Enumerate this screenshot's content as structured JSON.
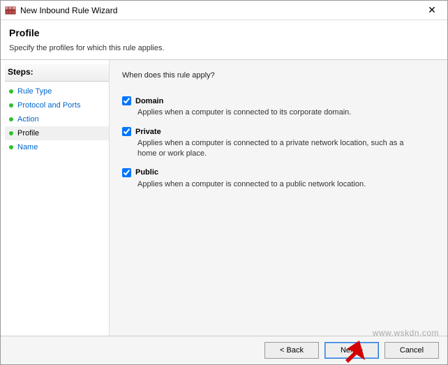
{
  "window": {
    "title": "New Inbound Rule Wizard"
  },
  "header": {
    "title": "Profile",
    "subtitle": "Specify the profiles for which this rule applies."
  },
  "steps": {
    "title": "Steps:",
    "items": [
      {
        "label": "Rule Type",
        "current": false
      },
      {
        "label": "Protocol and Ports",
        "current": false
      },
      {
        "label": "Action",
        "current": false
      },
      {
        "label": "Profile",
        "current": true
      },
      {
        "label": "Name",
        "current": false
      }
    ]
  },
  "content": {
    "question": "When does this rule apply?",
    "options": [
      {
        "title": "Domain",
        "checked": true,
        "desc": "Applies when a computer is connected to its corporate domain."
      },
      {
        "title": "Private",
        "checked": true,
        "desc": "Applies when a computer is connected to a private network location, such as a home or work place."
      },
      {
        "title": "Public",
        "checked": true,
        "desc": "Applies when a computer is connected to a public network location."
      }
    ]
  },
  "footer": {
    "back": "< Back",
    "next": "Next >",
    "cancel": "Cancel"
  },
  "watermark": "www.wskdn.com"
}
